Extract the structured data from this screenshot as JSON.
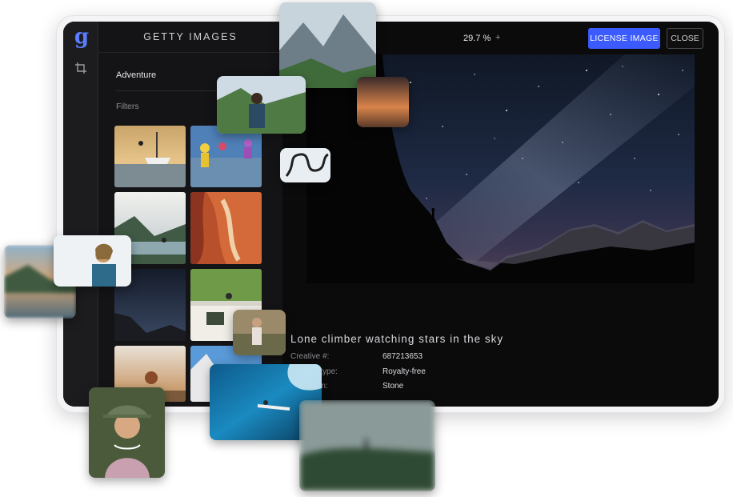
{
  "app": {
    "logo_letter": "g",
    "panel_title": "GETTY IMAGES",
    "search_term": "Adventure",
    "filters_label": "Filters"
  },
  "toolbar": {
    "zoom_level": "29.7 %",
    "zoom_plus": "+",
    "license_label": "LICENSE IMAGE",
    "close_label": "CLOSE"
  },
  "image": {
    "title": "Lone climber watching stars in the sky",
    "details": [
      {
        "label": "Creative #:",
        "value": "687213653"
      },
      {
        "label": "License type:",
        "value": "Royalty-free"
      },
      {
        "label": "Collection:",
        "value": "Stone"
      }
    ]
  },
  "colors": {
    "accent": "#3b5bff",
    "logo": "#5a7cff",
    "screen_bg": "#0b0b0c"
  },
  "icons": {
    "crop": "crop-icon"
  }
}
